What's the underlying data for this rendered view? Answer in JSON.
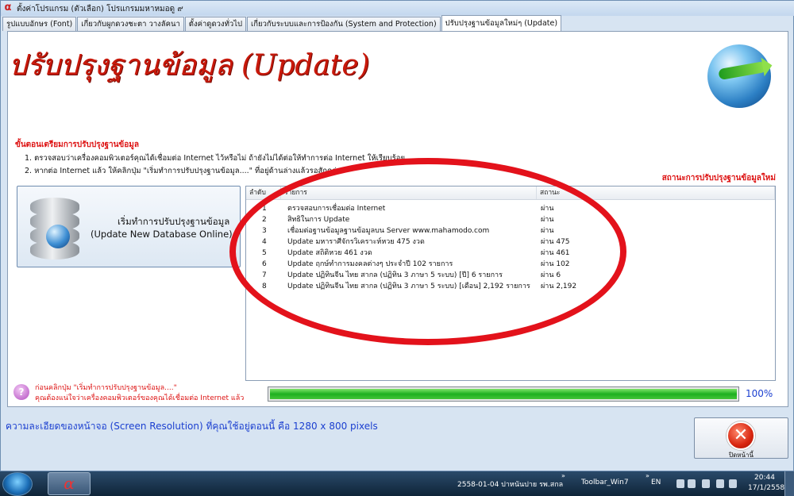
{
  "window": {
    "title": "ตั้งค่าโปรแกรม (ตัวเลือก) โปรแกรมมหาหมอดู ๙"
  },
  "tabs": [
    {
      "label": "รูปแบบอักษร (Font)",
      "active": false
    },
    {
      "label": "เกี่ยวกับผูกดวงชะตา วางลัคนา",
      "active": false
    },
    {
      "label": "ตั้งค่าดูดวงทั่วไป",
      "active": false
    },
    {
      "label": "เกี่ยวกับระบบและการป้องกัน (System and Protection)",
      "active": false
    },
    {
      "label": "ปรับปรุงฐานข้อมูลใหม่ๆ (Update)",
      "active": true
    }
  ],
  "page": {
    "title": "ปรับปรุงฐานข้อมูล (Update)",
    "prep_heading": "ขั้นตอนเตรียมการปรับปรุงฐานข้อมูล",
    "prep_steps": [
      "1. ตรวจสอบว่าเครื่องคอมพิวเตอร์คุณได้เชื่อมต่อ Internet ไว้หรือไม่ ถ้ายังไม่ได้ต่อให้ทำการต่อ Internet ให้เรียบร้อย",
      "2. หากต่อ Internet แล้ว ให้คลิกปุ่ม \"เริ่มทำการปรับปรุงฐานข้อมูล....\" ที่อยู่ด้านล่างแล้วรอสักครู่"
    ],
    "status_heading": "สถานะการปรับปรุงฐานข้อมูลใหม่"
  },
  "start_button": {
    "line1": "เริ่มทำการปรับปรุงฐานข้อมูล",
    "line2": "(Update New Database Online)"
  },
  "status_list": {
    "columns": [
      "ลำดับ",
      "รายการ",
      "สถานะ"
    ],
    "rows": [
      {
        "no": "1",
        "item": "ตรวจสอบการเชื่อมต่อ Internet",
        "status": "ผ่าน"
      },
      {
        "no": "2",
        "item": "สิทธิในการ Update",
        "status": "ผ่าน"
      },
      {
        "no": "3",
        "item": "เชื่อมต่อฐานข้อมูลฐานข้อมูลบน Server www.mahamodo.com",
        "status": "ผ่าน"
      },
      {
        "no": "4",
        "item": "Update มหาราศีจักรวิเคราะห์หวย 475 งวด",
        "status": "ผ่าน 475"
      },
      {
        "no": "5",
        "item": "Update สถิติหวย 461 งวด",
        "status": "ผ่าน 461"
      },
      {
        "no": "6",
        "item": "Update ฤกษ์ทำการมงคลต่างๆ ประจำปี 102 รายการ",
        "status": "ผ่าน 102"
      },
      {
        "no": "7",
        "item": "Update ปฏิทินจีน ไทย สากล (ปฏิทิน 3 ภาษา 5 ระบบ) [ปี] 6 รายการ",
        "status": "ผ่าน 6"
      },
      {
        "no": "8",
        "item": "Update ปฏิทินจีน ไทย สากล (ปฏิทิน 3 ภาษา 5 ระบบ) [เดือน] 2,192 รายการ",
        "status": "ผ่าน 2,192"
      }
    ]
  },
  "hint": {
    "line1": "ก่อนคลิกปุ่ม \"เริ่มทำการปรับปรุงฐานข้อมูล....\"",
    "line2": "คุณต้องแน่ใจว่าเครื่องคอมพิวเตอร์ของคุณได้เชื่อมต่อ Internet แล้ว"
  },
  "progress": {
    "value": 100,
    "label": "100%"
  },
  "resolution_text": "ความละเอียดของหน้าจอ (Screen Resolution) ที่คุณใช้อยู่ตอนนี้ คือ 1280 x 800 pixels",
  "close_button": {
    "label": "ปิดหน้านี้"
  },
  "taskbar": {
    "task_text": "2558-01-04 ปาหนันปาย รพ.สกล",
    "toolbar_label": "Toolbar_Win7",
    "language": "EN",
    "time": "20:44",
    "date": "17/1/2558"
  },
  "colors": {
    "accent_red": "#e3121b",
    "title_red": "#c8190b",
    "link_blue": "#1b3fd0",
    "progress_green": "#1db020"
  }
}
